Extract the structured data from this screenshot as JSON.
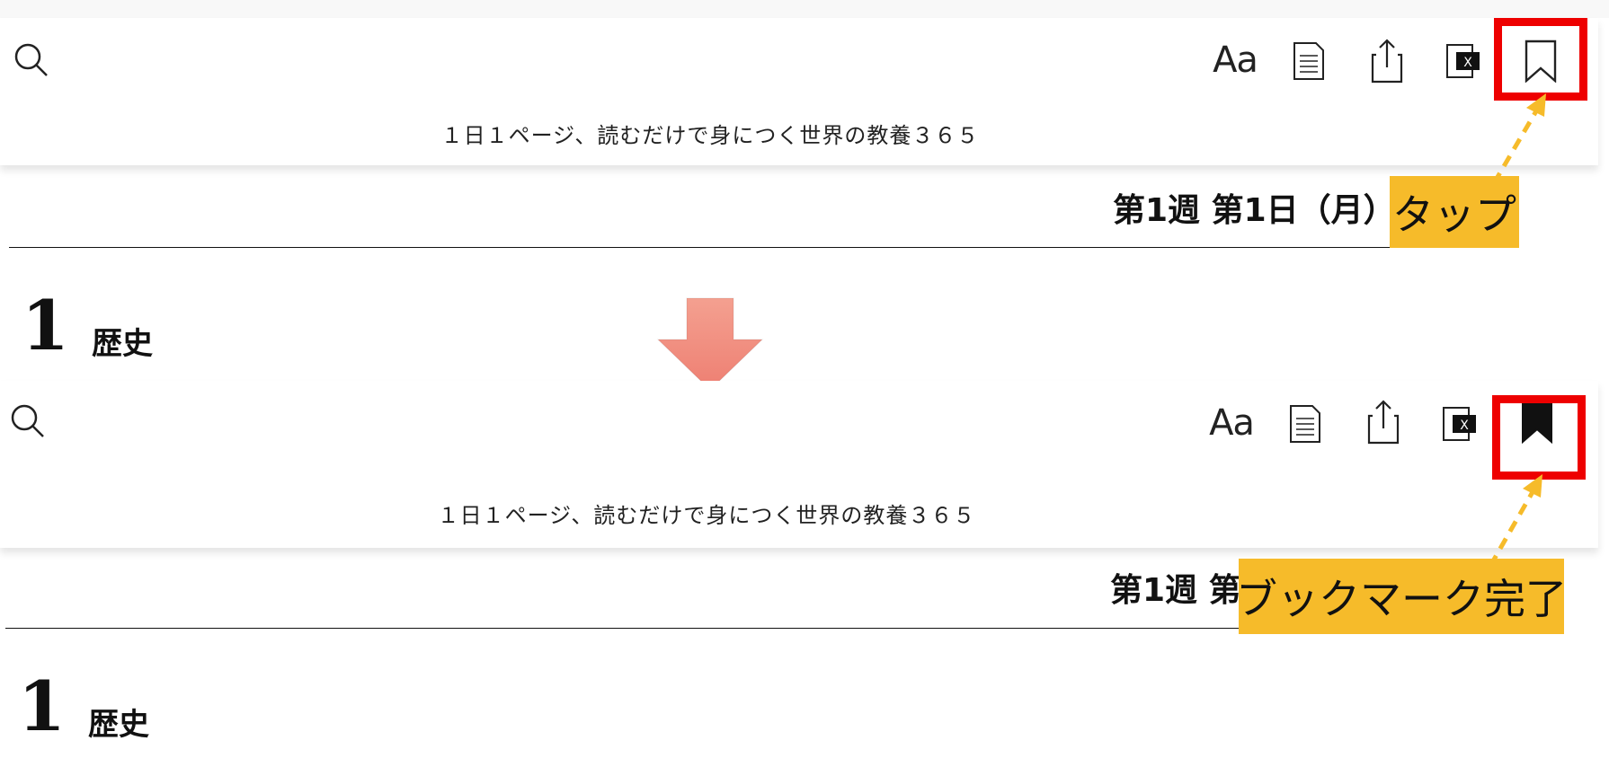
{
  "colors": {
    "highlight": "#ee0000",
    "callout": "#f6bb2a",
    "arrow": "#f4a090"
  },
  "before": {
    "toolbar": {
      "search_icon": "search-icon",
      "font_label": "Aa",
      "toc_icon": "document-icon",
      "share_icon": "share-icon",
      "xray_label": "X",
      "bookmark_icon": "bookmark-outline-icon"
    },
    "book_title": "１日１ページ、読むだけで身につく世界の教養３６５",
    "week_heading": "第1週 第1日（月）",
    "number": "1",
    "section": "歴史",
    "callout": "タップ"
  },
  "after": {
    "toolbar": {
      "search_icon": "search-icon",
      "font_label": "Aa",
      "toc_icon": "document-icon",
      "share_icon": "share-icon",
      "xray_label": "X",
      "bookmark_icon": "bookmark-filled-icon"
    },
    "book_title": "１日１ページ、読むだけで身につく世界の教養３６５",
    "week_heading": "第1週 第",
    "number": "1",
    "section": "歴史",
    "callout": "ブックマーク完了"
  }
}
